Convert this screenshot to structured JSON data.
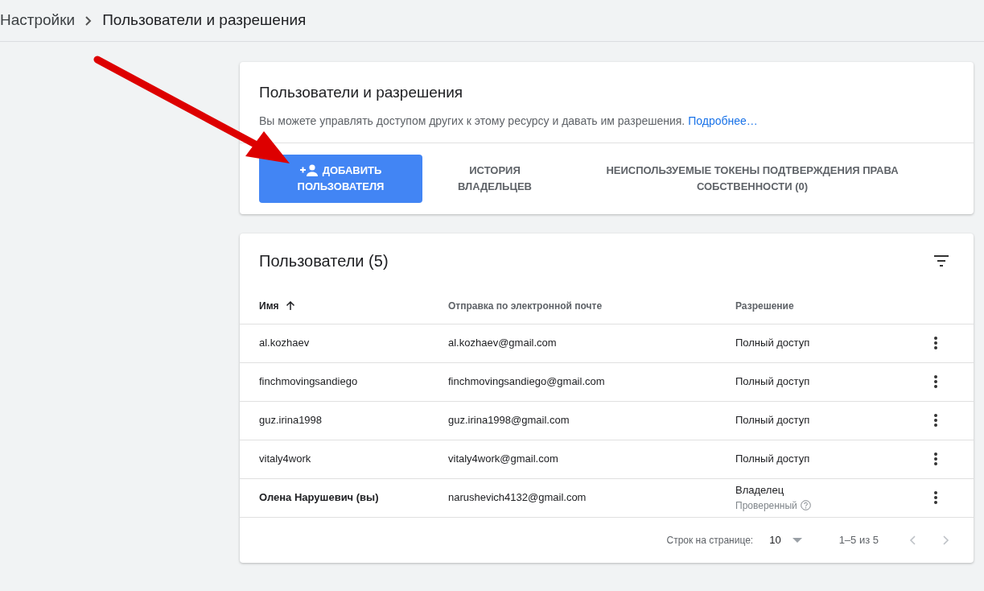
{
  "breadcrumb": [
    {
      "label": "Настройки"
    },
    {
      "label": "Пользователи и разрешения"
    }
  ],
  "intro_card": {
    "title": "Пользователи и разрешения",
    "description": "Вы можете управлять доступом других к этому ресурсу и давать им разрешения.",
    "link": "Подробнее…",
    "actions": [
      {
        "kind": "primary",
        "label": "ДОБАВИТЬ ПОЛЬЗОВАТЕЛЯ"
      },
      {
        "kind": "text",
        "label": "ИСТОРИЯ ВЛАДЕЛЬЦЕВ"
      },
      {
        "kind": "text",
        "label": "НЕИСПОЛЬЗУЕМЫЕ ТОКЕНЫ ПОДТВЕРЖДЕНИЯ ПРАВА СОБСТВЕННОСТИ (0)"
      }
    ]
  },
  "users_card": {
    "title": "Пользователи (5)",
    "columns": [
      {
        "label": "Имя",
        "sorted": true
      },
      {
        "label": "Отправка по электронной почте",
        "sorted": false
      },
      {
        "label": "Разрешение",
        "sorted": false
      }
    ],
    "rows": [
      {
        "name": "al.kozhaev",
        "email": "al.kozhaev@gmail.com",
        "permission": "Полный доступ",
        "current_user": false
      },
      {
        "name": "finchmovingsandiego",
        "email": "finchmovingsandiego@gmail.com",
        "permission": "Полный доступ",
        "current_user": false
      },
      {
        "name": "guz.irina1998",
        "email": "guz.irina1998@gmail.com",
        "permission": "Полный доступ",
        "current_user": false
      },
      {
        "name": "vitaly4work",
        "email": "vitaly4work@gmail.com",
        "permission": "Полный доступ",
        "current_user": false
      },
      {
        "name": "Олена Нарушевич (вы)",
        "email": "narushevich4132@gmail.com",
        "permission": "Владелец",
        "status": "Проверенный",
        "current_user": true
      }
    ],
    "pagination": {
      "rows_label": "Строк на странице:",
      "rows_value": "10",
      "range": "1–5 из 5",
      "prev_disabled": true,
      "next_disabled": true
    }
  }
}
